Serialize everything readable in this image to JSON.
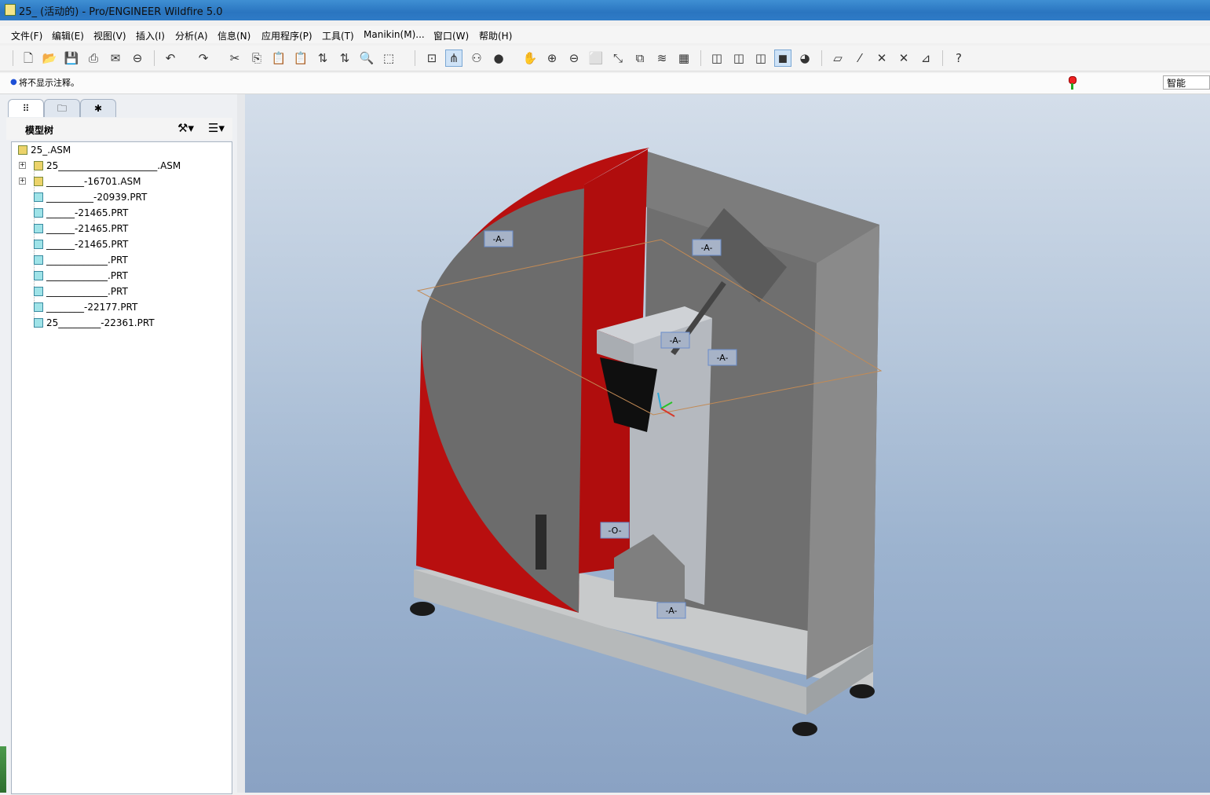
{
  "window": {
    "title": "25_ (活动的) - Pro/ENGINEER Wildfire 5.0"
  },
  "menu": {
    "items": [
      "文件(F)",
      "编辑(E)",
      "视图(V)",
      "插入(I)",
      "分析(A)",
      "信息(N)",
      "应用程序(P)",
      "工具(T)",
      "Manikin(M)...",
      "窗口(W)",
      "帮助(H)"
    ]
  },
  "toolbar": {
    "icons": [
      "new-file-icon",
      "open-file-icon",
      "save-icon",
      "print-icon",
      "email-icon",
      "close-window-icon",
      "undo-icon",
      "redo-icon",
      "cut-icon",
      "copy-icon",
      "paste-icon",
      "paste-special-icon",
      "regenerate-icon",
      "regen-manager-icon",
      "find-icon",
      "select-box-icon",
      "spin-center-icon",
      "datum-display-icon",
      "view-manager-icon",
      "shading-icon",
      "pan-icon",
      "zoom-in-icon",
      "zoom-out-icon",
      "refit-icon",
      "reorient-icon",
      "saved-views-icon",
      "layers-icon",
      "appearance-icon",
      "wireframe-icon",
      "hidden-line-icon",
      "no-hidden-icon",
      "shaded-icon",
      "enhanced-realism-icon",
      "datum-planes-icon",
      "datum-axes-icon",
      "datum-points-icon",
      "coordinate-systems-icon",
      "annotations-icon",
      "context-help-icon"
    ]
  },
  "message": {
    "text": "将不显示注释。",
    "filter": "智能"
  },
  "navigator": {
    "tabs": [
      "model-tree-tab",
      "folder-browser-tab",
      "favorites-tab"
    ],
    "header": "模型树",
    "tree": [
      {
        "label": "25_.ASM",
        "type": "asm",
        "level": 0,
        "expandable": false
      },
      {
        "label": "25_____________________.ASM",
        "type": "asm",
        "level": 1,
        "expandable": true
      },
      {
        "label": "________-16701.ASM",
        "type": "asm",
        "level": 1,
        "expandable": true
      },
      {
        "label": "__________-20939.PRT",
        "type": "prt",
        "level": 1,
        "expandable": false
      },
      {
        "label": "______-21465.PRT",
        "type": "prt",
        "level": 1,
        "expandable": false
      },
      {
        "label": "______-21465.PRT",
        "type": "prt",
        "level": 1,
        "expandable": false
      },
      {
        "label": "______-21465.PRT",
        "type": "prt",
        "level": 1,
        "expandable": false
      },
      {
        "label": "_____________.PRT",
        "type": "prt",
        "level": 1,
        "expandable": false
      },
      {
        "label": "_____________.PRT",
        "type": "prt",
        "level": 1,
        "expandable": false
      },
      {
        "label": "_____________.PRT",
        "type": "prt",
        "level": 1,
        "expandable": false
      },
      {
        "label": "________-22177.PRT",
        "type": "prt",
        "level": 1,
        "expandable": false
      },
      {
        "label": "25_________-22361.PRT",
        "type": "prt",
        "level": 1,
        "expandable": false
      }
    ]
  },
  "viewport": {
    "datum_tags": [
      "-A-",
      "-A-",
      "-A-",
      "-A-",
      "-O-",
      "-A-"
    ],
    "colors": {
      "guard_red": "#b80f0f",
      "housing_gray": "#6f6f6f",
      "base_gray": "#c8cacb",
      "tag_border": "#6a8ccb",
      "datum_plane": "#c28a55"
    }
  }
}
